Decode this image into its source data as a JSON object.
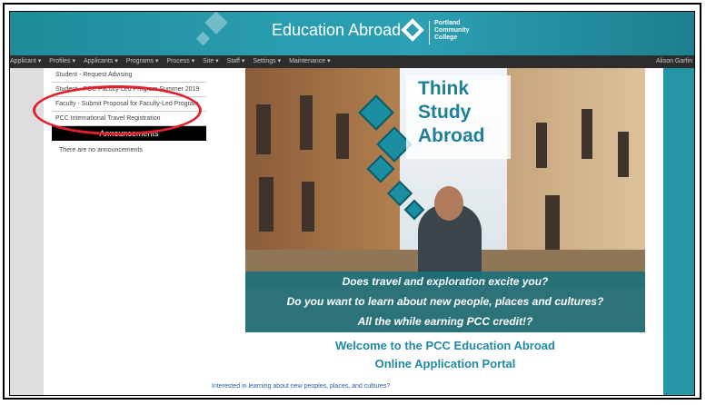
{
  "header": {
    "title": "Education Abroad",
    "logo_lines": [
      "Portland",
      "Community",
      "College"
    ]
  },
  "nav": {
    "items": [
      "Applicant ▾",
      "Profiles ▾",
      "Applicants ▾",
      "Programs ▾",
      "Process ▾",
      "Site ▾",
      "Staff ▾",
      "Settings ▾",
      "Maintenance ▾"
    ],
    "user": "Alison Garfin"
  },
  "sidebar": {
    "items": [
      "Student - Request Advising",
      "Student - PCC Faculty-Led Program Summer 2019",
      "Faculty - Submit Proposal for Faculty-Led Program",
      "PCC International Travel Registration"
    ],
    "announcements_title": "Announcements",
    "announcements_empty": "There are no announcements"
  },
  "hero": {
    "heading_lines": [
      "Think",
      "Study",
      "Abroad"
    ],
    "caption_lines": [
      "Does travel and exploration excite you?",
      "Do you want to learn about new people, places and cultures?",
      "All the while earning PCC credit!?"
    ]
  },
  "welcome": {
    "line1": "Welcome to the PCC Education Abroad",
    "line2": "Online Application Portal"
  },
  "intro": "Interested in learning about new peoples, places, and cultures?",
  "colors": {
    "teal": "#2a9db0",
    "highlight_red": "#e0212d"
  }
}
